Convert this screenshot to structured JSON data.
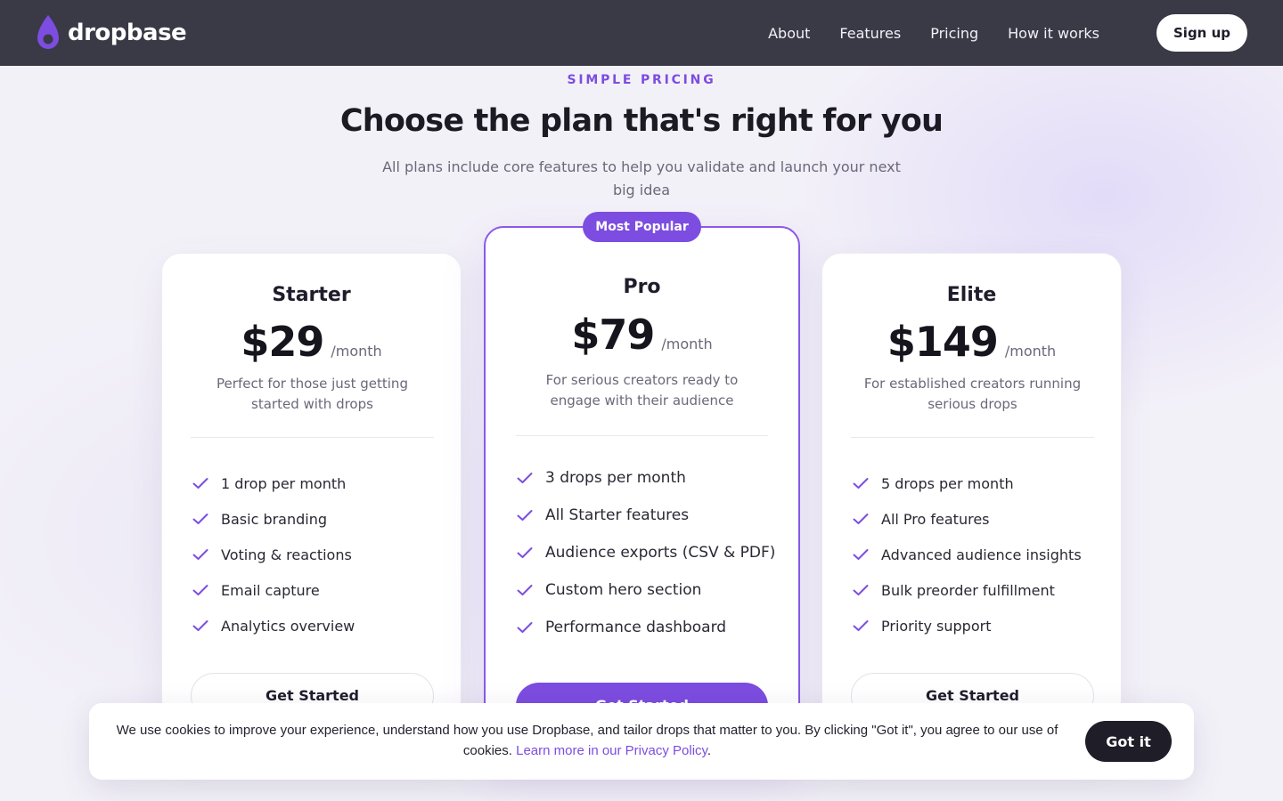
{
  "brand": {
    "name": "dropbase",
    "accent": "#7c4de0",
    "header_bg": "#3a3946"
  },
  "nav": {
    "items": [
      "About",
      "Features",
      "Pricing",
      "How it works"
    ],
    "signup_label": "Sign up"
  },
  "hero": {
    "eyebrow": "SIMPLE PRICING",
    "title": "Choose the plan that's right for you",
    "subtitle": "All plans include core features to help you validate and launch your next big idea"
  },
  "plans": [
    {
      "name": "Starter",
      "price": "$29",
      "period": "/month",
      "description": "Perfect for those just getting started with drops",
      "features": [
        "1 drop per month",
        "Basic branding",
        "Voting & reactions",
        "Email capture",
        "Analytics overview"
      ],
      "cta": "Get Started"
    },
    {
      "name": "Pro",
      "badge": "Most Popular",
      "price": "$79",
      "period": "/month",
      "description": "For serious creators ready to engage with their audience",
      "features": [
        "3 drops per month",
        "All Starter features",
        "Audience exports (CSV & PDF)",
        "Custom hero section",
        "Performance dashboard"
      ],
      "cta": "Get Started"
    },
    {
      "name": "Elite",
      "price": "$149",
      "period": "/month",
      "description": "For established creators running serious drops",
      "features": [
        "5 drops per month",
        "All Pro features",
        "Advanced audience insights",
        "Bulk preorder fulfillment",
        "Priority support"
      ],
      "cta": "Get Started"
    }
  ],
  "cookie": {
    "text": "We use cookies to improve your experience, understand how you use Dropbase, and tailor drops that matter to you. By clicking \"Got it\", you agree to our use of cookies.",
    "link_text": "Learn more in our Privacy Policy",
    "after_link": ".",
    "button_label": "Got it"
  }
}
